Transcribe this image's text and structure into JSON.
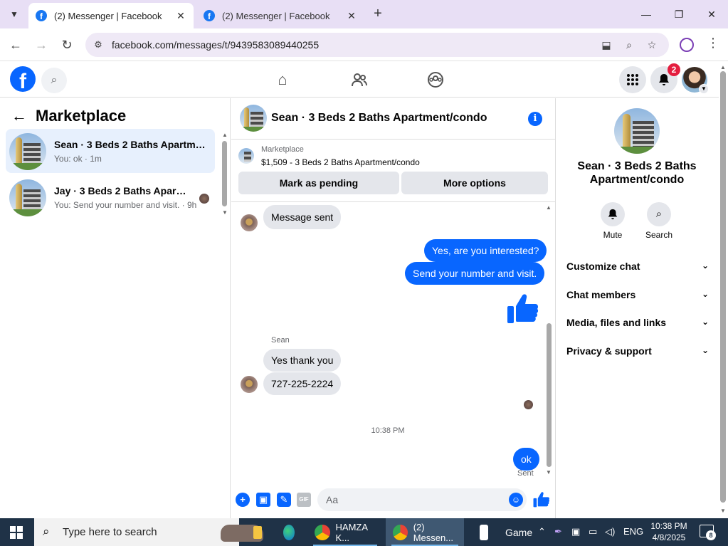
{
  "browser": {
    "tabs": [
      {
        "title": "(2) Messenger | Facebook",
        "active": true
      },
      {
        "title": "(2) Messenger | Facebook",
        "active": false
      }
    ],
    "url": "facebook.com/messages/t/9439583089440255",
    "icons": {
      "tab_search": "chevron-down-icon",
      "close": "close-icon",
      "new_tab": "plus-icon",
      "back": "arrow-left-icon",
      "forward": "arrow-right-icon",
      "reload": "reload-icon",
      "install": "install-app-icon",
      "zoom": "zoom-icon",
      "bookmark": "star-icon",
      "profile": "profile-icon",
      "menu": "kebab-menu-icon"
    }
  },
  "facebook_header": {
    "notification_count": "2",
    "icons": [
      "facebook-logo",
      "search-icon",
      "home-icon",
      "friends-icon",
      "groups-icon",
      "apps-grid-icon",
      "bell-icon"
    ]
  },
  "left_panel": {
    "title": "Marketplace",
    "conversations": [
      {
        "name": "Sean · 3 Beds 2 Baths Apartmen...",
        "preview": "You: ok · 1m",
        "active": true
      },
      {
        "name": "Jay · 3 Beds 2 Baths Apartme...",
        "preview": "You: Send your number and visit. · 9h",
        "active": false
      }
    ]
  },
  "chat": {
    "header_title": "Sean · 3 Beds 2 Baths Apartment/condo",
    "listing": {
      "category": "Marketplace",
      "title": "$1,509 - 3 Beds 2 Baths Apartment/condo",
      "buttons": {
        "mark_pending": "Mark as pending",
        "more_options": "More options"
      }
    },
    "messages": [
      {
        "dir": "in",
        "text": "Message sent"
      },
      {
        "dir": "out",
        "text": "Yes, are you interested?"
      },
      {
        "dir": "out",
        "text": "Send your number and visit."
      },
      {
        "dir": "out",
        "text": "",
        "sticker": "thumbs-up"
      },
      {
        "dir": "in",
        "sender": "Sean",
        "text": "Yes thank you"
      },
      {
        "dir": "in",
        "text": "727-225-2224"
      },
      {
        "dir": "out",
        "text": "ok"
      }
    ],
    "timestamp": "10:38 PM",
    "status": "Sent",
    "composer_placeholder": "Aa",
    "accent": "#0866ff"
  },
  "right_panel": {
    "name": "Sean · 3 Beds 2 Baths Apartment/condo",
    "actions": [
      {
        "label": "Mute",
        "icon": "bell-icon"
      },
      {
        "label": "Search",
        "icon": "search-icon"
      }
    ],
    "sections": [
      "Customize chat",
      "Chat members",
      "Media, files and links",
      "Privacy & support"
    ]
  },
  "taskbar": {
    "search_placeholder": "Type here to search",
    "apps": [
      {
        "label": "HAMZA K...",
        "active": false
      },
      {
        "label": "(2) Messen...",
        "active": true
      },
      {
        "label": "Game",
        "active": false
      }
    ],
    "language": "ENG",
    "time": "10:38 PM",
    "date": "4/8/2025",
    "notification_count": "8"
  }
}
